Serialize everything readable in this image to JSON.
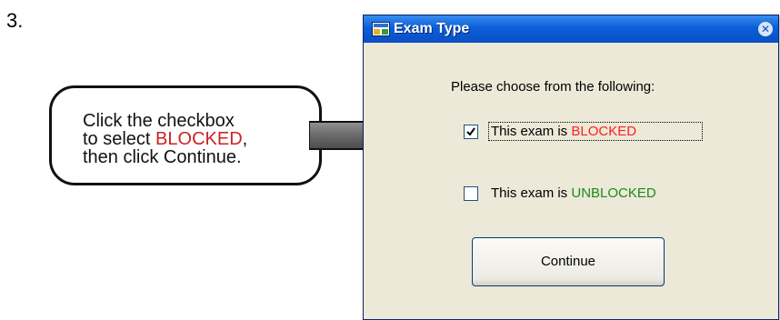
{
  "step": "3.",
  "callout": {
    "line1": "Click the checkbox",
    "line2_prefix": "to select ",
    "line2_emph": "BLOCKED",
    "line2_suffix": ",",
    "line3": "then click Continue."
  },
  "dialog": {
    "title": "Exam Type",
    "close_glyph": "✕",
    "prompt": "Please choose from the following:",
    "options": [
      {
        "prefix": "This exam is ",
        "word": "BLOCKED",
        "word_color": "#ff2020",
        "checked": true
      },
      {
        "prefix": "This exam is ",
        "word": "UNBLOCKED",
        "word_color": "#1c8a1c",
        "checked": false
      }
    ],
    "continue_label": "Continue"
  },
  "colors": {
    "titlebar": "#0a5fd8",
    "dialog_bg": "#ece9d8",
    "callout_emph": "#cc2222"
  }
}
